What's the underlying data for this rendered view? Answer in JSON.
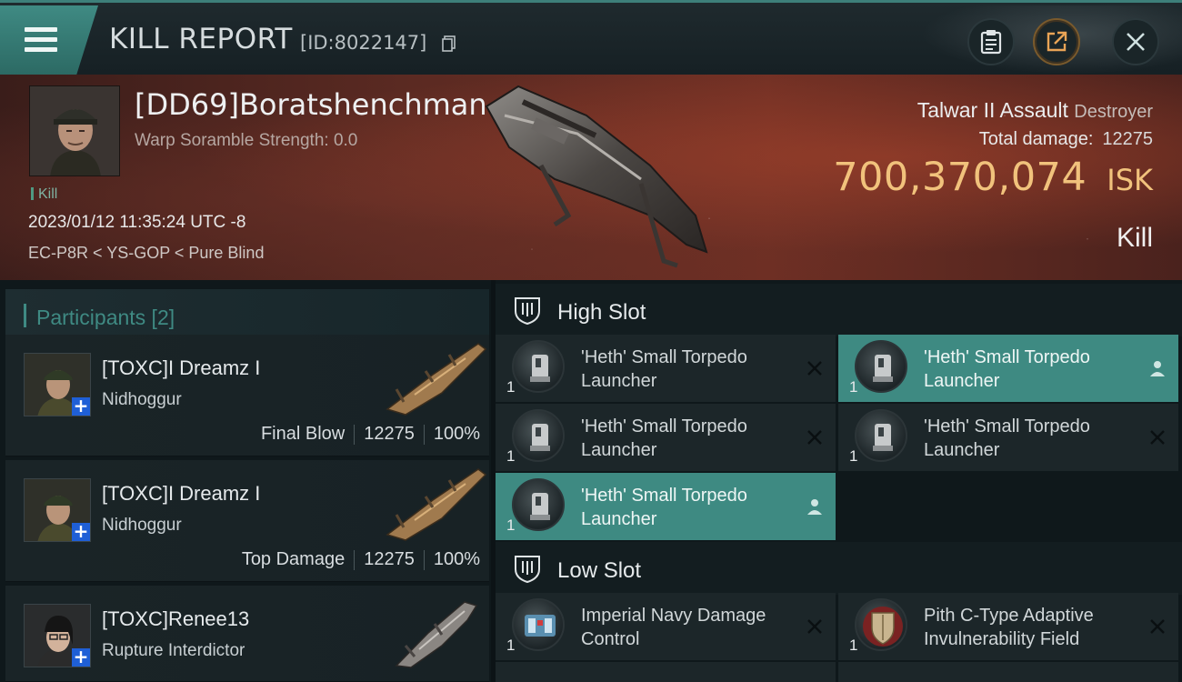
{
  "header": {
    "title": "KILL REPORT",
    "report_id": "[ID:8022147]",
    "menu_icon": "hamburger-menu-icon",
    "buttons": [
      {
        "icon": "clipboard-icon"
      },
      {
        "icon": "share-icon"
      },
      {
        "icon": "close-icon"
      }
    ]
  },
  "victim": {
    "name": "[DD69]Boratshenchman",
    "scramble": "Warp Soramble Strength: 0.0",
    "tag": "Kill",
    "datetime": "2023/01/12 11:35:24 UTC -8",
    "location": "EC-P8R < YS-GOP < Pure Blind",
    "ship_name": "Talwar II Assault",
    "ship_class": "Destroyer",
    "total_damage_label": "Total damage:",
    "total_damage": "12275",
    "isk_value": "700,370,074",
    "isk_unit": "ISK",
    "result": "Kill"
  },
  "participants": {
    "label": "Participants [2]",
    "items": [
      {
        "name": "[TOXC]I Dreamz I",
        "ship": "Nidhoggur",
        "role": "Final Blow",
        "damage": "12275",
        "percent": "100%"
      },
      {
        "name": "[TOXC]I Dreamz I",
        "ship": "Nidhoggur",
        "role": "Top Damage",
        "damage": "12275",
        "percent": "100%"
      },
      {
        "name": "[TOXC]Renee13",
        "ship": "Rupture Interdictor",
        "role": "",
        "damage": "",
        "percent": ""
      }
    ]
  },
  "slots": {
    "high": {
      "label": "High Slot",
      "modules": [
        {
          "name": "'Heth' Small Torpedo Launcher",
          "qty": "1",
          "status": "destroyed"
        },
        {
          "name": "'Heth' Small Torpedo Launcher",
          "qty": "1",
          "status": "dropped"
        },
        {
          "name": "'Heth' Small Torpedo Launcher",
          "qty": "1",
          "status": "destroyed"
        },
        {
          "name": "'Heth' Small Torpedo Launcher",
          "qty": "1",
          "status": "destroyed"
        },
        {
          "name": "'Heth' Small Torpedo Launcher",
          "qty": "1",
          "status": "dropped"
        }
      ]
    },
    "low": {
      "label": "Low Slot",
      "modules": [
        {
          "name": "Imperial Navy Damage Control",
          "qty": "1",
          "status": "destroyed"
        },
        {
          "name": "Pith C-Type Adaptive Invulnerability Field",
          "qty": "1",
          "status": "destroyed"
        }
      ]
    }
  },
  "colors": {
    "accent_teal": "#3e8a82",
    "isk_gold": "#f1c27c",
    "banner_red": "#6e2f24"
  }
}
